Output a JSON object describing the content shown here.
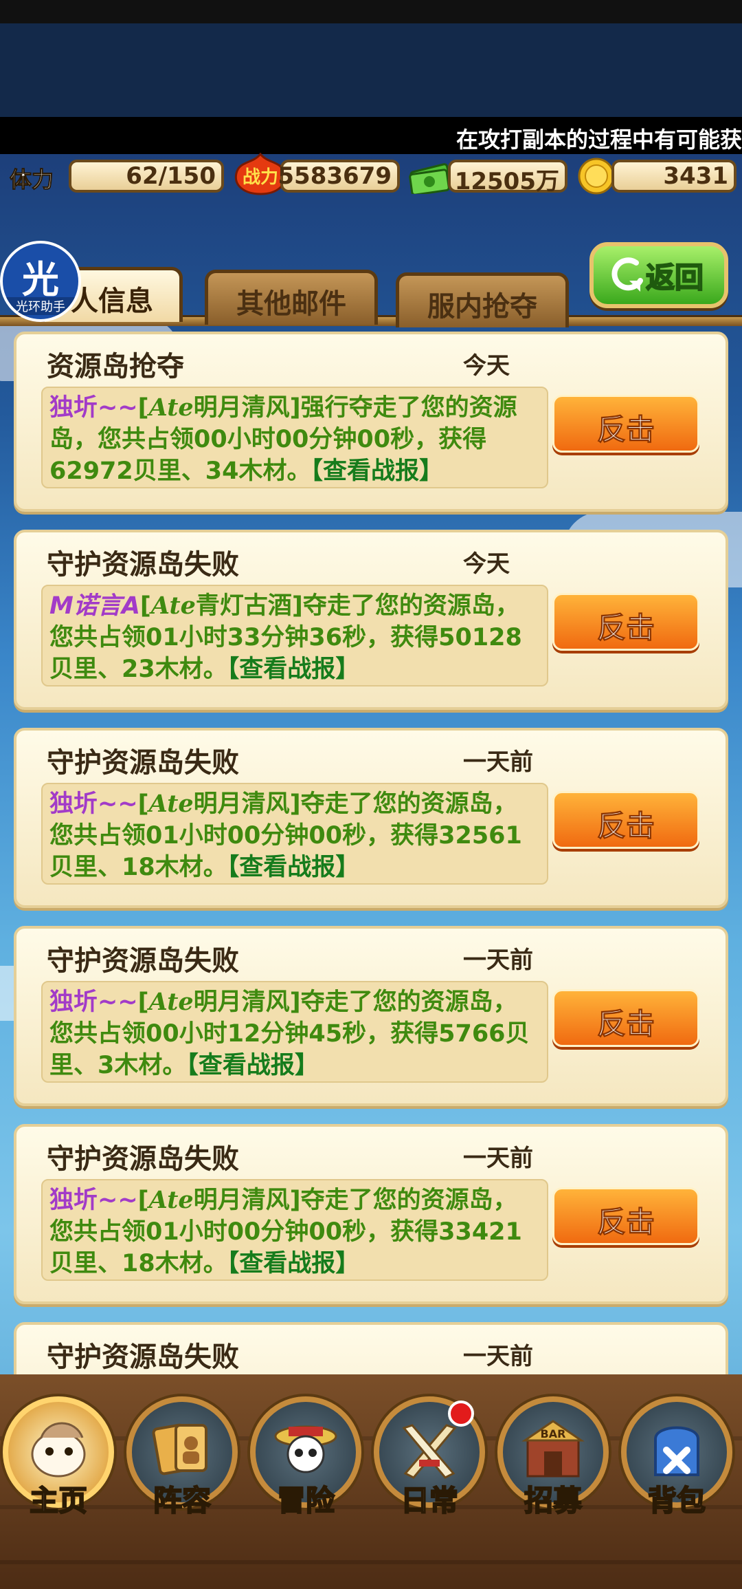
{
  "ticker": "在攻打副本的过程中有可能获",
  "stats": {
    "stamina_label": "体力",
    "stamina": "62/150",
    "power_icon_text": "战力",
    "power": "5583679",
    "money": "12505万",
    "gold": "3431"
  },
  "badge": {
    "big": "光",
    "small": "光环助手"
  },
  "tabs": [
    {
      "label": "人信息",
      "active": true
    },
    {
      "label": "其他邮件",
      "active": false
    },
    {
      "label": "服内抢夺",
      "active": false
    }
  ],
  "back_label": "返回",
  "mails": [
    {
      "title": "资源岛抢夺",
      "time": "今天",
      "player": "独圻~~",
      "guild_target": "[",
      "target_tag": "Ate",
      "target": "明月清风]",
      "verb": "强行夺走了您的资源岛，您共占领00小时00分钟00秒，获得62972贝里、34木材。",
      "link": "【查看战报】",
      "button": "反击"
    },
    {
      "title": "守护资源岛失败",
      "time": "今天",
      "player": "M诺言A",
      "guild_target": "[",
      "target_tag": "Ate",
      "target": "青灯古酒]",
      "verb": "夺走了您的资源岛，您共占领01小时33分钟36秒，获得50128贝里、23木材。",
      "link": "【查看战报】",
      "button": "反击"
    },
    {
      "title": "守护资源岛失败",
      "time": "一天前",
      "player": "独圻~~",
      "guild_target": "[",
      "target_tag": "Ate",
      "target": "明月清风]",
      "verb": "夺走了您的资源岛，您共占领01小时00分钟00秒，获得32561贝里、18木材。",
      "link": "【查看战报】",
      "button": "反击"
    },
    {
      "title": "守护资源岛失败",
      "time": "一天前",
      "player": "独圻~~",
      "guild_target": "[",
      "target_tag": "Ate",
      "target": "明月清风]",
      "verb": "夺走了您的资源岛，您共占领00小时12分钟45秒，获得5766贝里、3木材。",
      "link": "【查看战报】",
      "button": "反击"
    },
    {
      "title": "守护资源岛失败",
      "time": "一天前",
      "player": "独圻~~",
      "guild_target": "[",
      "target_tag": "Ate",
      "target": "明月清风]",
      "verb": "夺走了您的资源岛，您共占领01小时00分钟00秒，获得33421贝里、18木材。",
      "link": "【查看战报】",
      "button": "反击"
    },
    {
      "title": "守护资源岛失败",
      "time": "一天前"
    }
  ],
  "nav": [
    {
      "label": "主页",
      "icon": "home-icon"
    },
    {
      "label": "阵容",
      "icon": "lineup-icon"
    },
    {
      "label": "冒险",
      "icon": "skull-icon"
    },
    {
      "label": "日常",
      "icon": "swords-icon"
    },
    {
      "label": "招募",
      "icon": "bar-icon"
    },
    {
      "label": "背包",
      "icon": "backpack-icon"
    }
  ],
  "colors": {
    "accent_orange": "#f06a10",
    "back_green": "#3aa81c",
    "player_purple": "#a23bc8",
    "text_green": "#3f8a0f"
  }
}
